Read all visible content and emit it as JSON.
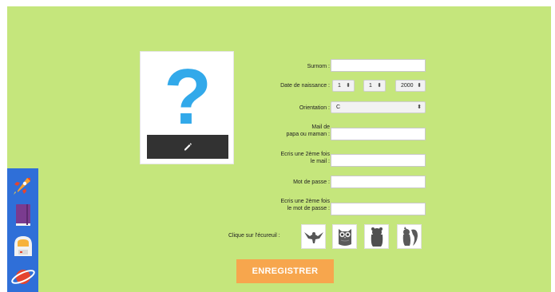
{
  "form": {
    "surnom_label": "Surnom :",
    "birth_label": "Date de naissance :",
    "birth_day": "1",
    "birth_month": "1",
    "birth_year": "2000",
    "orientation_label": "Orientation :",
    "orientation_value": "C",
    "email_label_1": "Mail de",
    "email_label_2": "papa ou maman :",
    "email_confirm_label_1": "Ecris une 2ème fois",
    "email_confirm_label_2": "le mail :",
    "password_label": "Mot de passe :",
    "password_confirm_label_1": "Ecris une 2ème fois",
    "password_confirm_label_2": "le mot de passe :",
    "captcha_label": "Clique sur l'écureuil :",
    "register_label": "ENREGISTRER",
    "select_arrow": "⬍"
  },
  "avatar": {
    "placeholder_glyph": "?",
    "edit_icon": "pencil-icon"
  },
  "captcha": {
    "options": [
      "eagle-icon",
      "owl-icon",
      "bear-icon",
      "squirrel-icon"
    ]
  },
  "sidebar": {
    "items": [
      "rocket-icon",
      "notebook-icon",
      "astronaut-helmet-icon",
      "planet-icon"
    ]
  },
  "colors": {
    "background": "#c5e67c",
    "question_mark": "#32a9ea",
    "edit_bar": "#323232",
    "register_button": "#f7a64d",
    "sidebar": "#2f6fd8"
  }
}
